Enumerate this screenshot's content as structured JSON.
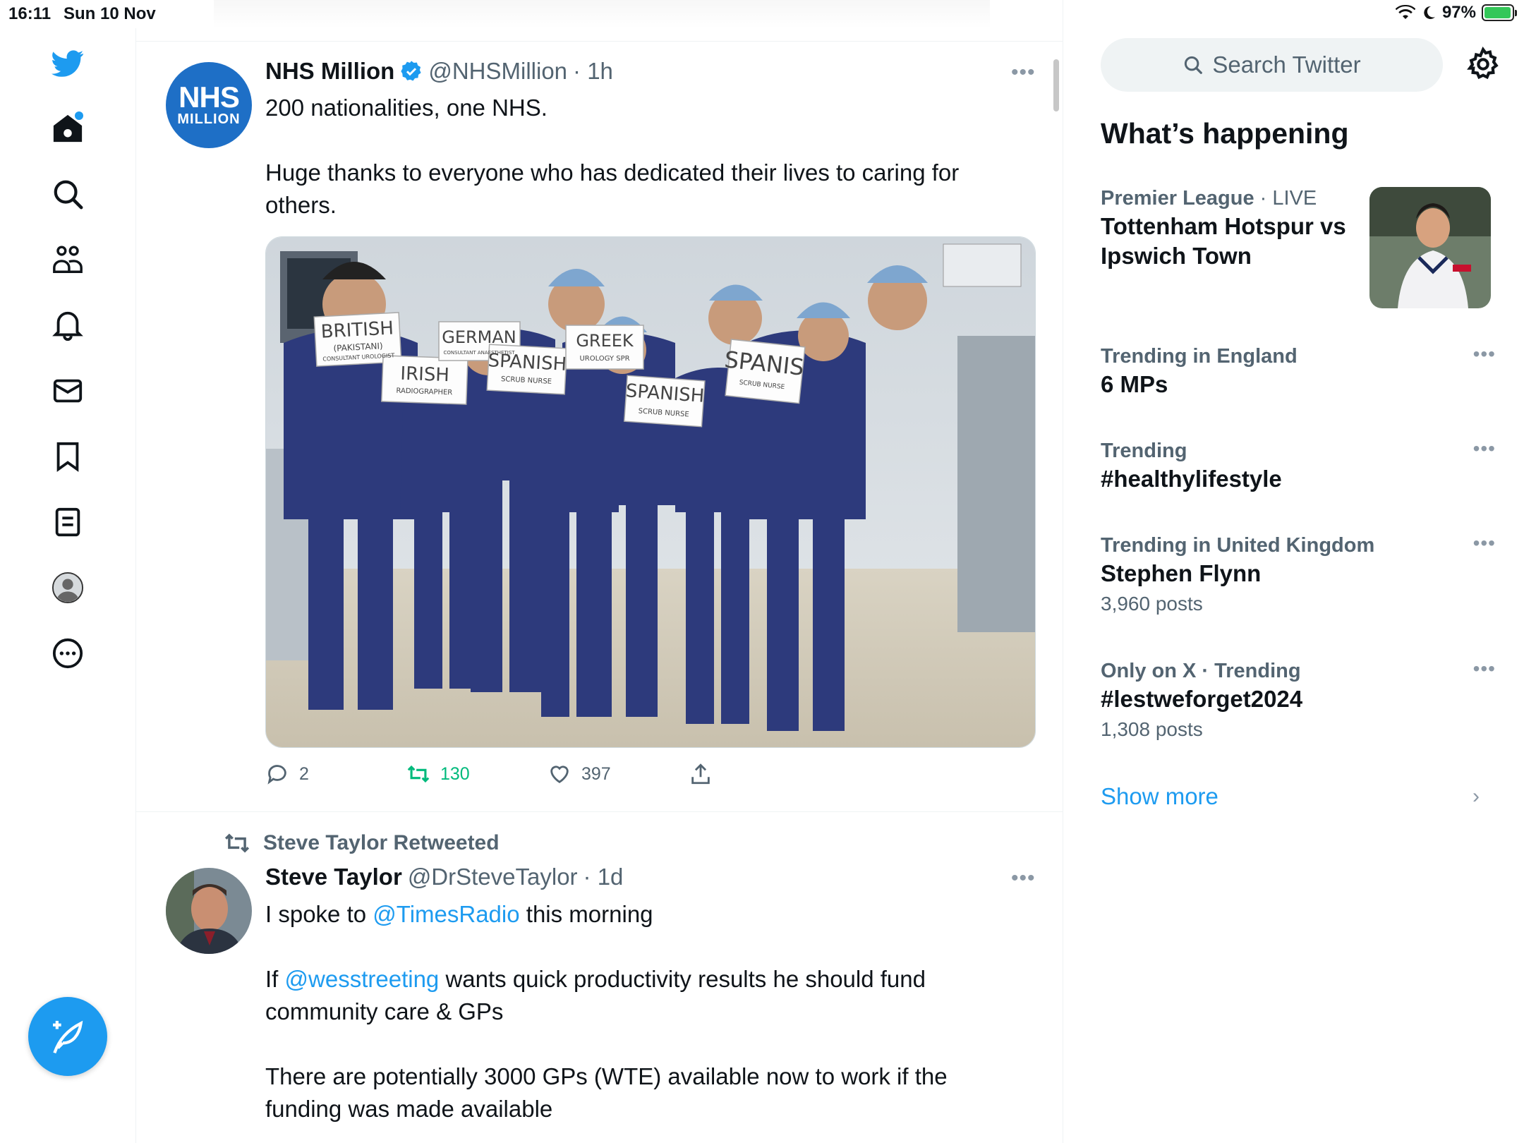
{
  "status": {
    "time": "16:11",
    "date": "Sun 10 Nov",
    "battery": "97%",
    "battery_level": 0.97
  },
  "nav": {
    "items": [
      "twitter-logo",
      "home",
      "explore",
      "communities",
      "notifications",
      "messages",
      "bookmarks",
      "lists",
      "profile",
      "more"
    ]
  },
  "tweets": [
    {
      "avatar_text_1": "NHS",
      "avatar_text_2": "MILLION",
      "name": "NHS Million",
      "verified": true,
      "handle": "@NHSMillion",
      "time": "· 1h",
      "lines": [
        "200 nationalities, one NHS.",
        "Huge thanks to everyone who has dedicated their lives to caring for others."
      ],
      "sign_labels": [
        {
          "big": "BRITISH",
          "small": "(PAKISTANI)",
          "tiny": "CONSULTANT UROLOGIST"
        },
        {
          "big": "IRISH",
          "small": "RADIOGRAPHER"
        },
        {
          "big": "GERMAN",
          "small": "CONSULTANT ANAESTHETIST"
        },
        {
          "big": "SPANISH",
          "small": "SCRUB NURSE"
        },
        {
          "big": "GREEK",
          "small": "UROLOGY SPR"
        },
        {
          "big": "SPANISH",
          "small": "SCRUB NURSE"
        },
        {
          "big": "SPANIS",
          "small": "SCRUB NURSE"
        }
      ],
      "replies": "2",
      "retweets": "130",
      "likes": "397"
    },
    {
      "retweeted_by": "Steve Taylor Retweeted",
      "name": "Steve Taylor",
      "handle": "@DrSteveTaylor",
      "time": "· 1d",
      "p1_pre": "I spoke to ",
      "p1_mention": "@TimesRadio",
      "p1_post": " this morning",
      "p2_pre": "If ",
      "p2_mention": "@wesstreeting",
      "p2_post": " wants quick productivity results he should fund community care & GPs",
      "p3": "There are potentially 3000 GPs (WTE) available now to work if the funding was made available"
    }
  ],
  "sidebar": {
    "search_placeholder": "Search Twitter",
    "title": "What’s happening",
    "trends": [
      {
        "ctx_bold": "Premier League",
        "ctx_rest": " · LIVE",
        "title": "Tottenham Hotspur vs Ipswich Town",
        "count": ""
      },
      {
        "ctx_bold": "Trending in England",
        "ctx_rest": "",
        "title": "6 MPs",
        "count": ""
      },
      {
        "ctx_bold": "Trending",
        "ctx_rest": "",
        "title": "#healthylifestyle",
        "count": ""
      },
      {
        "ctx_bold": "Trending in United Kingdom",
        "ctx_rest": "",
        "title": "Stephen Flynn",
        "count": "3,960 posts"
      },
      {
        "ctx_bold": "Only on X · Trending",
        "ctx_rest": "",
        "title": "#lestweforget2024",
        "count": "1,308 posts"
      }
    ],
    "show_more": "Show more"
  },
  "colors": {
    "accent": "#1d9bf0",
    "retweet": "#00ba7c",
    "muted": "#536471"
  }
}
